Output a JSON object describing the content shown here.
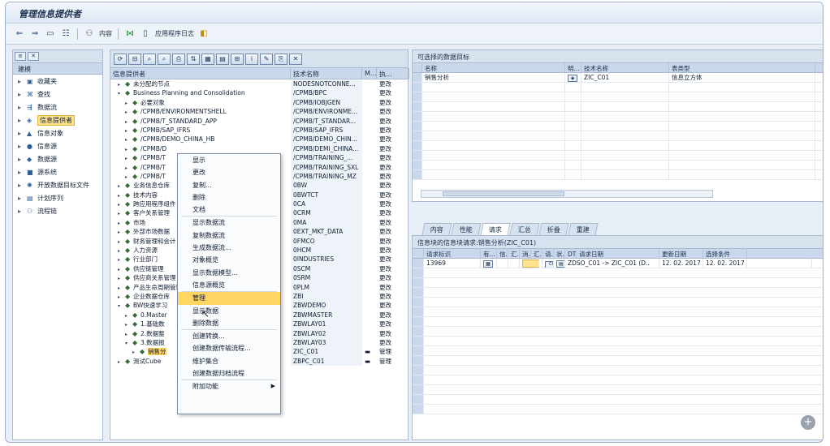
{
  "window": {
    "title": "管理信息提供者"
  },
  "toolbar": {
    "items": [
      "内容",
      "应用程序日志"
    ]
  },
  "nav": {
    "header": "建模",
    "items": [
      {
        "label": "收藏夹",
        "icon": "folder-icon"
      },
      {
        "label": "查找",
        "icon": "binoculars-icon"
      },
      {
        "label": "数据流",
        "icon": "dataflow-icon"
      },
      {
        "label": "信息提供者",
        "icon": "infoprovider-icon",
        "selected": true
      },
      {
        "label": "信息对象",
        "icon": "infoobject-icon"
      },
      {
        "label": "信息源",
        "icon": "infosource-icon"
      },
      {
        "label": "数据源",
        "icon": "datasource-icon"
      },
      {
        "label": "源系统",
        "icon": "sourcesystem-icon"
      },
      {
        "label": "开放数据目标文件",
        "icon": "opendata-icon"
      },
      {
        "label": "计划序列",
        "icon": "schedule-icon"
      },
      {
        "label": "流程链",
        "icon": "processchain-icon"
      }
    ]
  },
  "tree": {
    "columns": [
      "信息提供者",
      "技术名称",
      "M...",
      "执..."
    ],
    "rows": [
      {
        "name": "未分配的节点",
        "tech": "NODESNOTCONNE...",
        "m": "",
        "act": "更改",
        "indent": 1,
        "exp": "▸"
      },
      {
        "name": "Business Planning and Consolidation",
        "tech": "/CPMB/BPC",
        "m": "",
        "act": "更改",
        "indent": 1,
        "exp": "▾"
      },
      {
        "name": "必要对象",
        "tech": "/CPMB/IOBJGEN",
        "m": "",
        "act": "更改",
        "indent": 2,
        "exp": "▸"
      },
      {
        "name": "/CPMB/ENVIRONMENTSHELL",
        "tech": "/CPMB/ENVIRONME...",
        "m": "",
        "act": "更改",
        "indent": 2,
        "exp": "▸"
      },
      {
        "name": "/CPMB/T_STANDARD_APP",
        "tech": "/CPMB/T_STANDAR...",
        "m": "",
        "act": "更改",
        "indent": 2,
        "exp": "▸"
      },
      {
        "name": "/CPMB/SAP_IFRS",
        "tech": "/CPMB/SAP_IFRS",
        "m": "",
        "act": "更改",
        "indent": 2,
        "exp": "▸"
      },
      {
        "name": "/CPMB/DEMO_CHINA_HB",
        "tech": "/CPMB/DEMO_CHIN...",
        "m": "",
        "act": "更改",
        "indent": 2,
        "exp": "▸"
      },
      {
        "name": "/CPMB/D",
        "tech": "/CPMB/DEMI_CHINA...",
        "m": "",
        "act": "更改",
        "indent": 2,
        "exp": "▸"
      },
      {
        "name": "/CPMB/T",
        "tech": "/CPMB/TRAINING_...",
        "m": "",
        "act": "更改",
        "indent": 2,
        "exp": "▸"
      },
      {
        "name": "/CPMB/T",
        "tech": "/CPMB/TRAINING_SXL",
        "m": "",
        "act": "更改",
        "indent": 2,
        "exp": "▸"
      },
      {
        "name": "/CPMB/T",
        "tech": "/CPMB/TRAINING_MZ",
        "m": "",
        "act": "更改",
        "indent": 2,
        "exp": "▸"
      },
      {
        "name": "业务信息仓库",
        "tech": "0BW",
        "m": "",
        "act": "更改",
        "indent": 1,
        "exp": "▸"
      },
      {
        "name": "技术内容",
        "tech": "0BWTCT",
        "m": "",
        "act": "更改",
        "indent": 1,
        "exp": "▸"
      },
      {
        "name": "跨应用程序组件",
        "tech": "0CA",
        "m": "",
        "act": "更改",
        "indent": 1,
        "exp": "▸"
      },
      {
        "name": "客户关系管理",
        "tech": "0CRM",
        "m": "",
        "act": "更改",
        "indent": 1,
        "exp": "▸"
      },
      {
        "name": "市场",
        "tech": "0MA",
        "m": "",
        "act": "更改",
        "indent": 1,
        "exp": "▸"
      },
      {
        "name": "外部市场数据",
        "tech": "0EXT_MKT_DATA",
        "m": "",
        "act": "更改",
        "indent": 1,
        "exp": "▸"
      },
      {
        "name": "财务管理和会计",
        "tech": "0FMCO",
        "m": "",
        "act": "更改",
        "indent": 1,
        "exp": "▸"
      },
      {
        "name": "人力资源",
        "tech": "0HCM",
        "m": "",
        "act": "更改",
        "indent": 1,
        "exp": "▸"
      },
      {
        "name": "行业部门",
        "tech": "0INDUSTRIES",
        "m": "",
        "act": "更改",
        "indent": 1,
        "exp": "▸"
      },
      {
        "name": "供应链管理",
        "tech": "0SCM",
        "m": "",
        "act": "更改",
        "indent": 1,
        "exp": "▸"
      },
      {
        "name": "供应商关系管理",
        "tech": "0SRM",
        "m": "",
        "act": "更改",
        "indent": 1,
        "exp": "▸"
      },
      {
        "name": "产品生命周期管理",
        "tech": "0PLM",
        "m": "",
        "act": "更改",
        "indent": 1,
        "exp": "▸"
      },
      {
        "name": "企业数据仓库",
        "tech": "ZBI",
        "m": "",
        "act": "更改",
        "indent": 1,
        "exp": "▸"
      },
      {
        "name": "BW快速学习",
        "tech": "ZBWDEMO",
        "m": "",
        "act": "更改",
        "indent": 1,
        "exp": "▾"
      },
      {
        "name": "0.Master",
        "tech": "ZBWMASTER",
        "m": "",
        "act": "更改",
        "indent": 2,
        "exp": "▸"
      },
      {
        "name": "1.基础数",
        "tech": "ZBWLAY01",
        "m": "",
        "act": "更改",
        "indent": 2,
        "exp": "▸"
      },
      {
        "name": "2.数据整",
        "tech": "ZBWLAY02",
        "m": "",
        "act": "更改",
        "indent": 2,
        "exp": "▸"
      },
      {
        "name": "3.数据报",
        "tech": "ZBWLAY03",
        "m": "",
        "act": "更改",
        "indent": 2,
        "exp": "▾"
      },
      {
        "name": "销售分",
        "tech": "ZIC_C01",
        "m": "▬",
        "act": "管理",
        "indent": 3,
        "exp": "▸",
        "selected": true
      },
      {
        "name": "测试Cube",
        "tech": "ZBPC_C01",
        "m": "▬",
        "act": "管理",
        "indent": 1,
        "exp": "▸"
      }
    ]
  },
  "context_menu": {
    "items": [
      {
        "label": "显示"
      },
      {
        "label": "更改"
      },
      {
        "label": "复制..."
      },
      {
        "label": "删除"
      },
      {
        "label": "文档",
        "sep_after": true
      },
      {
        "label": "显示数据流"
      },
      {
        "label": "复制数据流"
      },
      {
        "label": "生成数据流..."
      },
      {
        "label": "对象概览"
      },
      {
        "label": "显示数据模型..."
      },
      {
        "label": "信息源概览",
        "sep_after": true
      },
      {
        "label": "管理",
        "highlighted": true
      },
      {
        "label": "显示数据"
      },
      {
        "label": "删除数据",
        "sep_after": true
      },
      {
        "label": "创建转换..."
      },
      {
        "label": "创建数据传输流程..."
      },
      {
        "label": "维护集合"
      },
      {
        "label": "创建数据归档流程",
        "sep_after": true
      },
      {
        "label": "附加功能",
        "submenu": true
      }
    ]
  },
  "objects_panel": {
    "title": "可选择的数据目标",
    "columns": [
      "名称",
      "明...",
      "技术名称",
      "表类型"
    ],
    "rows": [
      {
        "name": "销售分析",
        "icon": "cube-icon",
        "tech": "ZIC_C01",
        "type": "信息立方体"
      }
    ]
  },
  "tabs": [
    "内容",
    "性能",
    "请求",
    "汇总",
    "折叠",
    "重建"
  ],
  "active_tab": "请求",
  "requests_panel": {
    "title": "信息块的信息块请求:销售分析(ZIC_C01)",
    "columns": [
      "请求标识",
      "有...",
      "信...",
      "汇...",
      "消...",
      "汇...",
      "请...",
      "状...",
      "DTP/信息包",
      "请求日期",
      "更新日期",
      "选择条件"
    ],
    "rows": [
      {
        "id": "13969",
        "dtp": "ZDSO_C01 -> ZIC_C01 (D..",
        "req_date": "12. 02. 2017",
        "upd_date": "12. 02. 2017"
      }
    ]
  },
  "colors": {
    "accent": "#ffd564",
    "chrome": "#d7e2ef",
    "border": "#a9bad0"
  }
}
